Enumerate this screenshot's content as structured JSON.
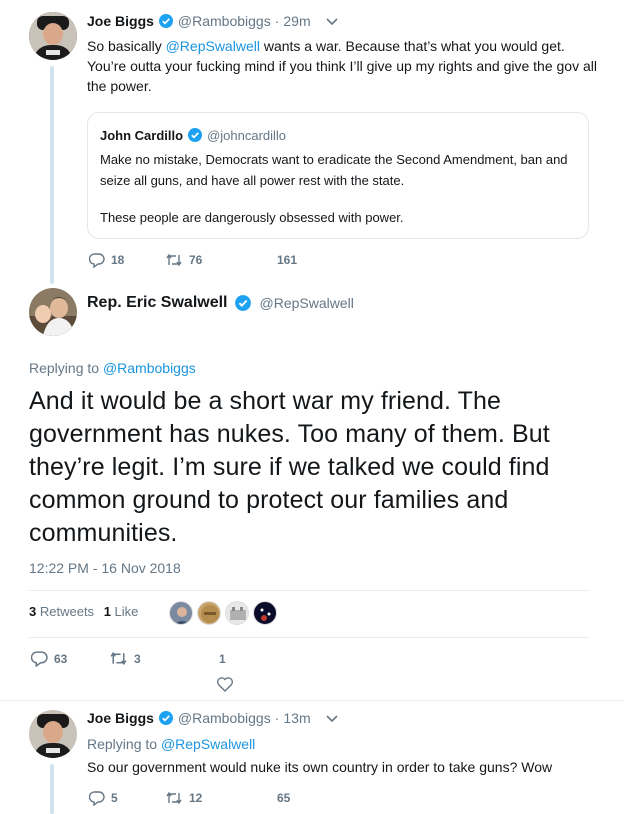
{
  "tweet1": {
    "name": "Joe Biggs",
    "handle": "@Rambobiggs",
    "time": "29m",
    "text_before": "So basically ",
    "mention": "@RepSwalwell",
    "text_after": " wants a war. Because that’s what you would get. You’re outta your fucking mind if you think I’ll give up my rights and give the gov all the power.",
    "quote": {
      "name": "John Cardillo",
      "handle": "@johncardillo",
      "para1": "Make no mistake, Democrats want to eradicate the Second Amendment, ban and seize all guns, and have all power rest with the state.",
      "para2": "These people are dangerously obsessed with power."
    },
    "replies": "18",
    "retweets": "76",
    "likes": "161"
  },
  "main": {
    "name": "Rep. Eric Swalwell",
    "handle": "@RepSwalwell",
    "replying_label": "Replying to ",
    "replying_to": "@Rambobiggs",
    "text": "And it would be a short war my friend. The government has nukes. Too many of them. But they’re legit. I’m sure if we talked we could find common ground to protect our families and communities.",
    "timestamp": "12:22 PM - 16 Nov 2018",
    "retweet_count": "3",
    "retweet_label": "Retweets",
    "like_count": "1",
    "like_label": "Like",
    "replies": "63",
    "retweets": "3",
    "likes": "1"
  },
  "tweet3": {
    "name": "Joe Biggs",
    "handle": "@Rambobiggs",
    "time": "13m",
    "replying_label": "Replying to ",
    "replying_to": "@RepSwalwell",
    "text": "So our government would nuke its own country in order to take guns? Wow",
    "replies": "5",
    "retweets": "12",
    "likes": "65"
  },
  "colors": {
    "accent": "#1b95e0",
    "verified": "#1da1f2",
    "muted": "#657786",
    "thread_line": "#cfe3ef"
  },
  "icons": [
    "reply-icon",
    "retweet-icon",
    "like-icon",
    "verified-icon",
    "chevron-down-icon"
  ]
}
